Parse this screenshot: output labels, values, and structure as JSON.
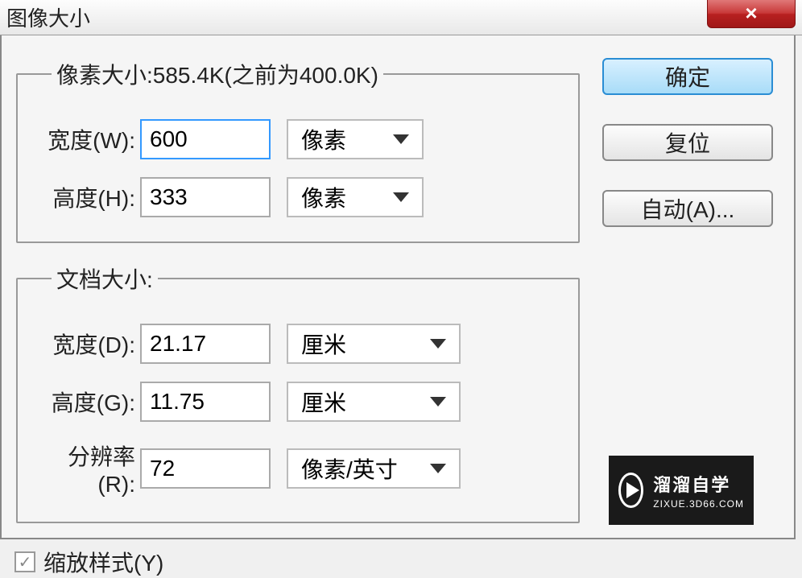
{
  "window": {
    "title": "图像大小",
    "close_icon": "×"
  },
  "pixel_section": {
    "legend": "像素大小:585.4K(之前为400.0K)",
    "width_label": "宽度(W):",
    "width_value": "600",
    "width_unit": "像素",
    "height_label": "高度(H):",
    "height_value": "333",
    "height_unit": "像素"
  },
  "doc_section": {
    "legend": "文档大小:",
    "width_label": "宽度(D):",
    "width_value": "21.17",
    "width_unit": "厘米",
    "height_label": "高度(G):",
    "height_value": "11.75",
    "height_unit": "厘米",
    "resolution_label": "分辨率(R):",
    "resolution_value": "72",
    "resolution_unit": "像素/英寸"
  },
  "buttons": {
    "ok": "确定",
    "reset": "复位",
    "auto": "自动(A)..."
  },
  "checkbox": {
    "scale_styles_label": "缩放样式(Y)",
    "scale_styles_checked": "✓"
  },
  "watermark": {
    "main": "溜溜自学",
    "sub": "ZIXUE.3D66.COM"
  }
}
